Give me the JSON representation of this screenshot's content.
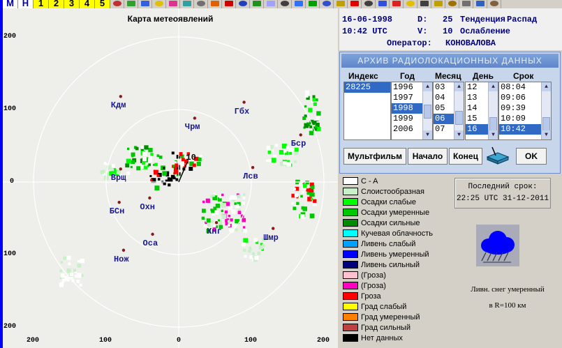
{
  "toolbar": {
    "buttons": [
      "M",
      "H",
      "1",
      "2",
      "3",
      "4",
      "5"
    ],
    "button_colors": [
      "#ffffff",
      "#ffffff",
      "#ffff00",
      "#ffff00",
      "#ffff00",
      "#ffff00",
      "#ffff00"
    ],
    "icons": [
      "cursor-icon",
      "scissors-icon",
      "globe-icon",
      "radar-icon",
      "palette-icon",
      "marker-icon",
      "compass-icon",
      "target-icon",
      "bomb-icon",
      "hand-icon",
      "grid-icon",
      "window-icon",
      "thermometer-icon",
      "up-arrow-icon",
      "plane-icon",
      "down-arrow-icon",
      "pencil-icon",
      "cross-icon",
      "line-icon",
      "down-blue-icon",
      "down-red-icon",
      "lamp-icon",
      "star-icon",
      "clock-icon",
      "book-icon",
      "printer-icon",
      "key-icon",
      "wrench-icon"
    ]
  },
  "map": {
    "title": "Карта метеоявлений",
    "y_ticks": [
      {
        "label": "200",
        "y": 200
      },
      {
        "label": "100",
        "y": 100
      },
      {
        "label": "0",
        "y": 0
      },
      {
        "label": "100",
        "y": -100
      },
      {
        "label": "200",
        "y": -200
      }
    ],
    "x_ticks": [
      {
        "label": "200",
        "x": -200
      },
      {
        "label": "100",
        "x": -100
      },
      {
        "label": "0",
        "x": 0
      },
      {
        "label": "100",
        "x": 100
      },
      {
        "label": "200",
        "x": 200
      }
    ],
    "cities": [
      {
        "name": "Кдм",
        "x": -80,
        "y": 118
      },
      {
        "name": "Гбх",
        "x": 90,
        "y": 110
      },
      {
        "name": "Чрм",
        "x": 22,
        "y": 88
      },
      {
        "name": "Бср",
        "x": 168,
        "y": 65
      },
      {
        "name": "Врщ",
        "x": -80,
        "y": 18
      },
      {
        "name": "Лсв",
        "x": 102,
        "y": 20
      },
      {
        "name": "БСн",
        "x": -82,
        "y": -28
      },
      {
        "name": "Охн",
        "x": -40,
        "y": -22
      },
      {
        "name": "Кнг",
        "x": 52,
        "y": -56
      },
      {
        "name": "Шмр",
        "x": 130,
        "y": -64
      },
      {
        "name": "Оса",
        "x": -36,
        "y": -72
      },
      {
        "name": "Нож",
        "x": -76,
        "y": -94
      }
    ],
    "station_label": "10"
  },
  "info": {
    "date": "16-06-1998",
    "d_label": "D:",
    "d_value": "25",
    "tendency_label": "Тенденция",
    "tendency_value": "Распад",
    "time": "10:42 UTC",
    "v_label": "V:",
    "v_value": "10",
    "weakening": "Ослабление",
    "operator_label": "Оператор:",
    "operator_value": "КОНОВАЛОВА"
  },
  "archive": {
    "title": "АРХИВ  РАДИОЛОКАЦИОННЫХ  ДАННЫХ",
    "headers": [
      "Индекс",
      "Год",
      "Месяц",
      "День",
      "Срок"
    ],
    "index_list": {
      "items": [
        "28225"
      ],
      "selected": 0
    },
    "year_list": {
      "items": [
        "1996",
        "1997",
        "1998",
        "1999",
        "2006"
      ],
      "selected": 2
    },
    "month_list": {
      "items": [
        "03",
        "04",
        "05",
        "06",
        "07"
      ],
      "selected": 3
    },
    "day_list": {
      "items": [
        "12",
        "13",
        "14",
        "15",
        "16"
      ],
      "selected": 4
    },
    "term_list": {
      "items": [
        "08:04",
        "09:06",
        "09:39",
        "10:09",
        "10:42"
      ],
      "selected": 4
    },
    "buttons": {
      "multfilm": "Мультфильм",
      "start": "Начало",
      "end": "Конец",
      "ok": "OK"
    }
  },
  "legend": [
    {
      "label": "C - A",
      "color": "#ffffff"
    },
    {
      "label": "Слоистообразная",
      "color": "#c8f0c8"
    },
    {
      "label": "Осадки слабые",
      "color": "#00ff00"
    },
    {
      "label": "Осадки умеренные",
      "color": "#00c800"
    },
    {
      "label": "Осадки сильные",
      "color": "#008c00"
    },
    {
      "label": "Кучевая облачность",
      "color": "#00ffff"
    },
    {
      "label": "Ливень слабый",
      "color": "#00a0ff"
    },
    {
      "label": "Ливень умеренный",
      "color": "#0000ff"
    },
    {
      "label": "Ливень сильный",
      "color": "#000080"
    },
    {
      "label": "(Гроза)",
      "color": "#ffc0d0"
    },
    {
      "label": "(Гроза)",
      "color": "#ff00c0"
    },
    {
      "label": "Гроза",
      "color": "#ff0000"
    },
    {
      "label": "Град слабый",
      "color": "#ffff00"
    },
    {
      "label": "Град умеренный",
      "color": "#ff8000"
    },
    {
      "label": "Град сильный",
      "color": "#c04040"
    },
    {
      "label": "Нет данных",
      "color": "#000000"
    }
  ],
  "last_term": {
    "label": "Последний срок:",
    "value": "22:25 UTC 31-12-2011"
  },
  "weather": {
    "icon": "cloud-snow-shower-icon",
    "line1": "Ливн. снег умеренный",
    "line2": "в R=100 км"
  }
}
